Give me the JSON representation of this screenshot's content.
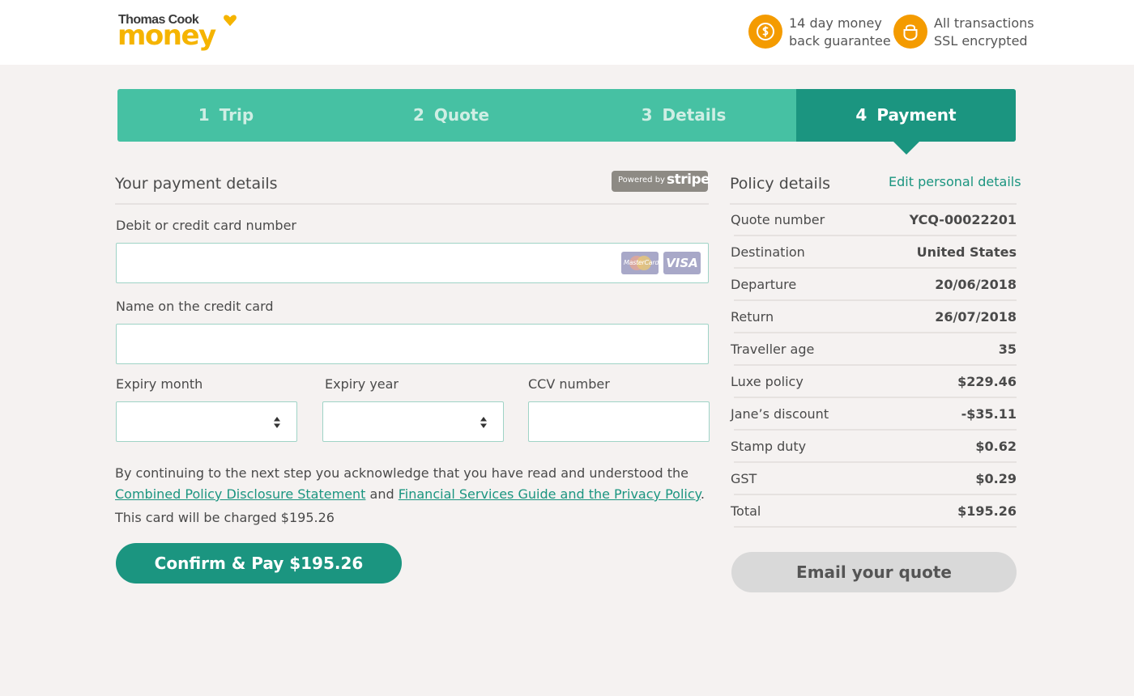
{
  "header": {
    "logo_top": "Thomas Cook",
    "logo_bottom": "money",
    "guarantee_line1": "14 day money",
    "guarantee_line2": "back guarantee",
    "ssl_line1": "All transactions",
    "ssl_line2": "SSL encrypted",
    "accent_color": "#f49b00"
  },
  "steps": [
    {
      "num": "1",
      "label": "Trip"
    },
    {
      "num": "2",
      "label": "Quote"
    },
    {
      "num": "3",
      "label": "Details"
    },
    {
      "num": "4",
      "label": "Payment"
    }
  ],
  "payment": {
    "title": "Your payment details",
    "stripe_powered": "Powered by",
    "stripe_brand": "stripe",
    "card_number_label": "Debit or credit card number",
    "card_number_value": "",
    "mastercard_text": "MasterCard",
    "visa_text": "VISA",
    "name_label": "Name on the credit card",
    "name_value": "",
    "expiry_month_label": "Expiry month",
    "expiry_month_value": "",
    "expiry_year_label": "Expiry year",
    "expiry_year_value": "",
    "ccv_label": "CCV number",
    "ccv_value": "",
    "ack_text": "By continuing to the next step you acknowledge that you have read and understood the",
    "ack_link1": "Combined Policy Disclosure Statement",
    "ack_and": "and",
    "ack_link2": "Financial Services Guide and the Privacy Policy",
    "ack_end": ".",
    "charge_text": "This card will be charged $195.26",
    "confirm_label": "Confirm & Pay $195.26"
  },
  "policy": {
    "title": "Policy details",
    "edit_label": "Edit personal details",
    "rows": [
      {
        "key": "Quote number",
        "value": "YCQ-00022201"
      },
      {
        "key": "Destination",
        "value": "United States"
      },
      {
        "key": "Departure",
        "value": "20/06/2018"
      },
      {
        "key": "Return",
        "value": "26/07/2018"
      },
      {
        "key": "Traveller age",
        "value": "35"
      },
      {
        "key": "Luxe policy",
        "value": "$229.46"
      },
      {
        "key": "Jane’s discount",
        "value": "-$35.11"
      },
      {
        "key": "Stamp duty",
        "value": "$0.62"
      },
      {
        "key": "GST",
        "value": "$0.29"
      },
      {
        "key": "Total",
        "value": "$195.26"
      }
    ],
    "email_label": "Email your quote"
  },
  "colors": {
    "teal": "#46c1a3",
    "teal_dark": "#1b9580",
    "background": "#f5f2f1"
  }
}
